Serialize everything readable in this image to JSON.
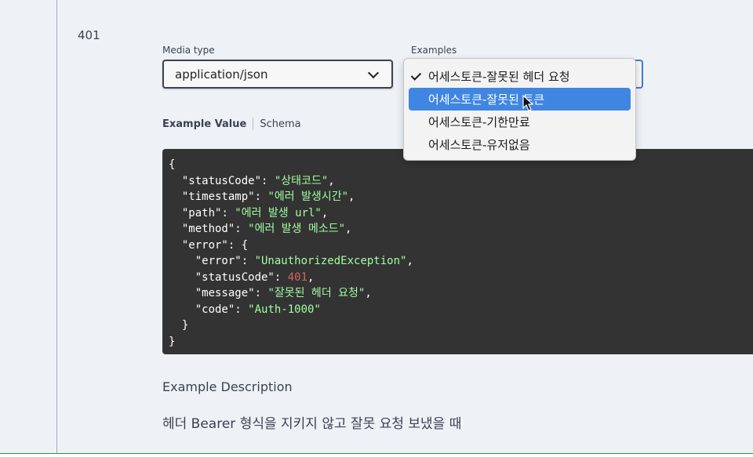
{
  "response": {
    "status_code": "401"
  },
  "media_type": {
    "label": "Media type",
    "value": "application/json"
  },
  "examples": {
    "label": "Examples",
    "options": [
      {
        "label": "어세스토큰-잘못된 헤더 요청",
        "selected": true
      },
      {
        "label": "어세스토큰-잘못된 토큰",
        "highlighted": true
      },
      {
        "label": "어세스토큰-기한만료"
      },
      {
        "label": "어세스토큰-유저없음"
      }
    ]
  },
  "tabs": {
    "example_value": "Example Value",
    "schema": "Schema"
  },
  "code": {
    "open": "{",
    "l1_key": "  \"statusCode\"",
    "l1_val": "\"상태코드\"",
    "l2_key": "  \"timestamp\"",
    "l2_val": "\"에러 발생시간\"",
    "l3_key": "  \"path\"",
    "l3_val": "\"에러 발생 url\"",
    "l4_key": "  \"method\"",
    "l4_val": "\"에러 발생 메소드\"",
    "l5_key": "  \"error\"",
    "l5_rest": ": {",
    "e1_key": "    \"error\"",
    "e1_val": "\"UnauthorizedException\"",
    "e2_key": "    \"statusCode\"",
    "e2_val": "401",
    "e3_key": "    \"message\"",
    "e3_val": "\"잘못된 헤더 요청\"",
    "e4_key": "    \"code\"",
    "e4_val": "\"Auth-1000\"",
    "inner_close": "  }",
    "close": "}"
  },
  "description": {
    "title": "Example Description",
    "text": "헤더 Bearer 형식을 지키지 않고 잘못 요청 보냈을 때"
  }
}
